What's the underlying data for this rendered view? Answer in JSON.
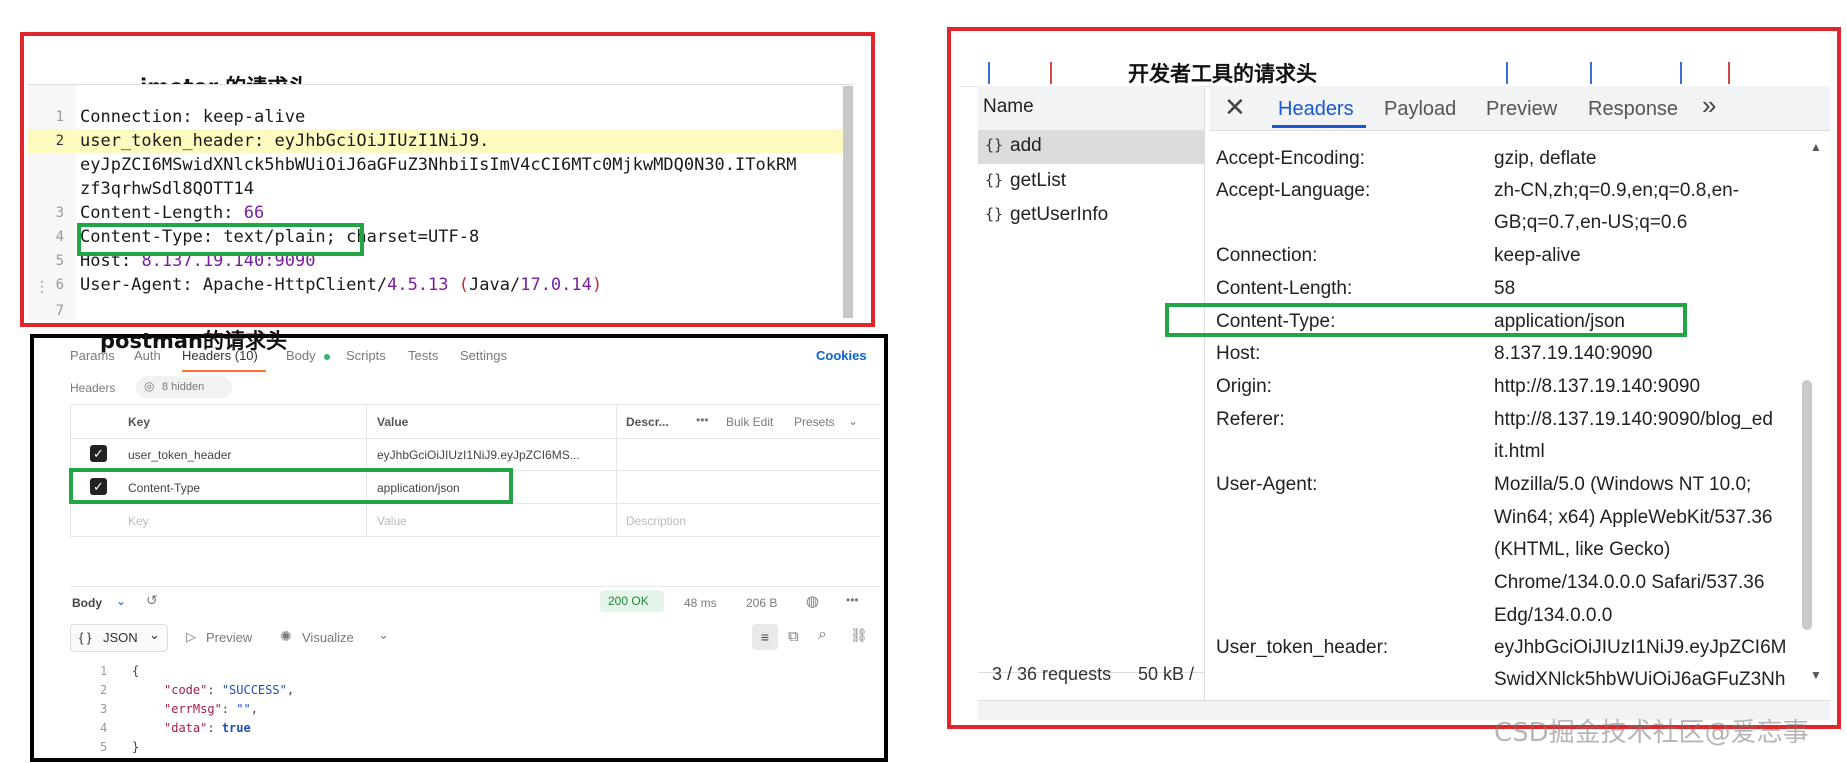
{
  "jmeter": {
    "caption": "jmeter 的请求头",
    "lines": [
      {
        "num": "1",
        "key": "Connection",
        "value": "keep-alive"
      },
      {
        "num": "2",
        "key": "user_token_header",
        "value": "eyJhbGciOiJIUzI1NiJ9.",
        "cont1": "eyJpZCI6MSwidXNlck5hbWUiOiJ6aGFuZ3NhbiIsImV4cCI6MTc0MjkwMDQ0N30.ITokRM",
        "cont2": "zf3qrhwSdl8QOTT14"
      },
      {
        "num": "3",
        "key": "Content-Length",
        "value": "66"
      },
      {
        "num": "4",
        "key": "Content-Type",
        "value": "text/plain;",
        "extra": "charset=UTF-8"
      },
      {
        "num": "5",
        "key": "Host",
        "value": "8.137.19.140:9090"
      },
      {
        "num": "6",
        "key": "User-Agent",
        "value_a": "Apache-HttpClient",
        "value_b": "4.5.13",
        "value_c": "Java",
        "value_d": "17.0.14"
      },
      {
        "num": "7"
      }
    ]
  },
  "postman": {
    "caption": "postman的请求头",
    "tabs": [
      "Params",
      "Auth",
      "Headers (10)",
      "Body",
      "Scripts",
      "Tests",
      "Settings"
    ],
    "cookies": "Cookies",
    "headers_label": "Headers",
    "hidden_label": "8 hidden",
    "columns": {
      "key": "Key",
      "value": "Value",
      "desc": "Descr...",
      "bulk": "Bulk Edit",
      "presets": "Presets"
    },
    "rows": [
      {
        "key": "user_token_header",
        "value": "eyJhbGciOiJIUzI1NiJ9.eyJpZCI6MS..."
      },
      {
        "key": "Content-Type",
        "value": "application/json"
      }
    ],
    "empty_row": {
      "key": "Key",
      "value": "Value",
      "desc": "Description"
    },
    "response": {
      "body_label": "Body",
      "status": "200 OK",
      "time": "48 ms",
      "size": "206 B",
      "format": "JSON",
      "preview": "Preview",
      "visualize": "Visualize",
      "json_lines": [
        {
          "num": "1",
          "text": "{"
        },
        {
          "num": "2",
          "key": "\"code\"",
          "value": "\"SUCCESS\"",
          "comma": ","
        },
        {
          "num": "3",
          "key": "\"errMsg\"",
          "value": "\"\"",
          "comma": ","
        },
        {
          "num": "4",
          "key": "\"data\"",
          "value": "true",
          "comma": ""
        },
        {
          "num": "5",
          "text": "}"
        }
      ]
    }
  },
  "devtools": {
    "caption": "开发者工具的请求头",
    "name_header": "Name",
    "requests": [
      "add",
      "getList",
      "getUserInfo"
    ],
    "tabs": [
      "Headers",
      "Payload",
      "Preview",
      "Response"
    ],
    "headers": [
      {
        "key": "Accept-Encoding:",
        "value": "gzip, deflate"
      },
      {
        "key": "Accept-Language:",
        "value": "zh-CN,zh;q=0.9,en;q=0.8,en-",
        "value2": "GB;q=0.7,en-US;q=0.6"
      },
      {
        "key": "Connection:",
        "value": "keep-alive"
      },
      {
        "key": "Content-Length:",
        "value": "58"
      },
      {
        "key": "Content-Type:",
        "value": "application/json"
      },
      {
        "key": "Host:",
        "value": "8.137.19.140:9090"
      },
      {
        "key": "Origin:",
        "value": "http://8.137.19.140:9090"
      },
      {
        "key": "Referer:",
        "value": "http://8.137.19.140:9090/blog_ed",
        "value2": "it.html"
      },
      {
        "key": "User-Agent:",
        "value": "Mozilla/5.0 (Windows NT 10.0;",
        "value2": "Win64; x64) AppleWebKit/537.36",
        "value3": "(KHTML, like Gecko)",
        "value4": "Chrome/134.0.0.0 Safari/537.36",
        "value5": "Edg/134.0.0.0"
      },
      {
        "key": "User_token_header:",
        "value": "eyJhbGciOiJIUzI1NiJ9.eyJpZCI6M",
        "value2": "SwidXNlck5hbWUiOiJ6aGFuZ3Nh"
      }
    ],
    "status": "3 / 36 requests",
    "transfer": "50 kB /"
  },
  "watermark": "CSD掘金技术社区@爱忘事"
}
